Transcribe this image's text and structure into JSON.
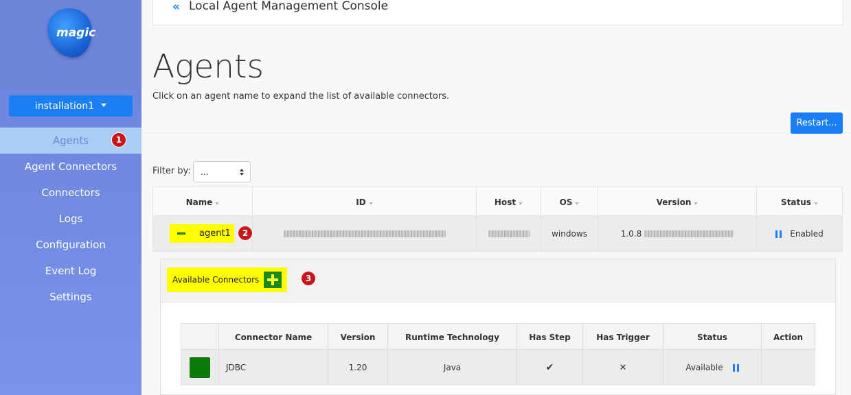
{
  "sidebar": {
    "logo_text": "magic",
    "installation": "installation1",
    "items": [
      {
        "label": "Agents"
      },
      {
        "label": "Agent Connectors"
      },
      {
        "label": "Connectors"
      },
      {
        "label": "Logs"
      },
      {
        "label": "Configuration"
      },
      {
        "label": "Event Log"
      },
      {
        "label": "Settings"
      }
    ]
  },
  "topbar": {
    "back": "«",
    "title": "Local Agent Management Console"
  },
  "main": {
    "title": "Agents",
    "description": "Click on an agent name to expand the list of available connectors.",
    "restart_label": "Restart...",
    "filter_label": "Filter by:",
    "filter_value": "..."
  },
  "agents_table": {
    "headers": [
      "Name",
      "ID",
      "Host",
      "OS",
      "Version",
      "Status"
    ],
    "rows": [
      {
        "name": "agent1",
        "os": "windows",
        "version_prefix": "1.0.8",
        "status": "Enabled"
      }
    ]
  },
  "connectors": {
    "header": "Available Connectors",
    "headers": [
      "",
      "Connector Name",
      "Version",
      "Runtime Technology",
      "Has Step",
      "Has Trigger",
      "Status",
      "Action"
    ],
    "rows": [
      {
        "name": "JDBC",
        "version": "1.20",
        "runtime": "Java",
        "has_step": "✔",
        "has_trigger": "✕",
        "status": "Available"
      }
    ]
  },
  "badges": [
    "1",
    "2",
    "3"
  ],
  "colors": {
    "accent": "#1a7ff2",
    "highlight": "#ffff00",
    "badge": "#c8161a",
    "sidebar": "#6f88e0"
  }
}
